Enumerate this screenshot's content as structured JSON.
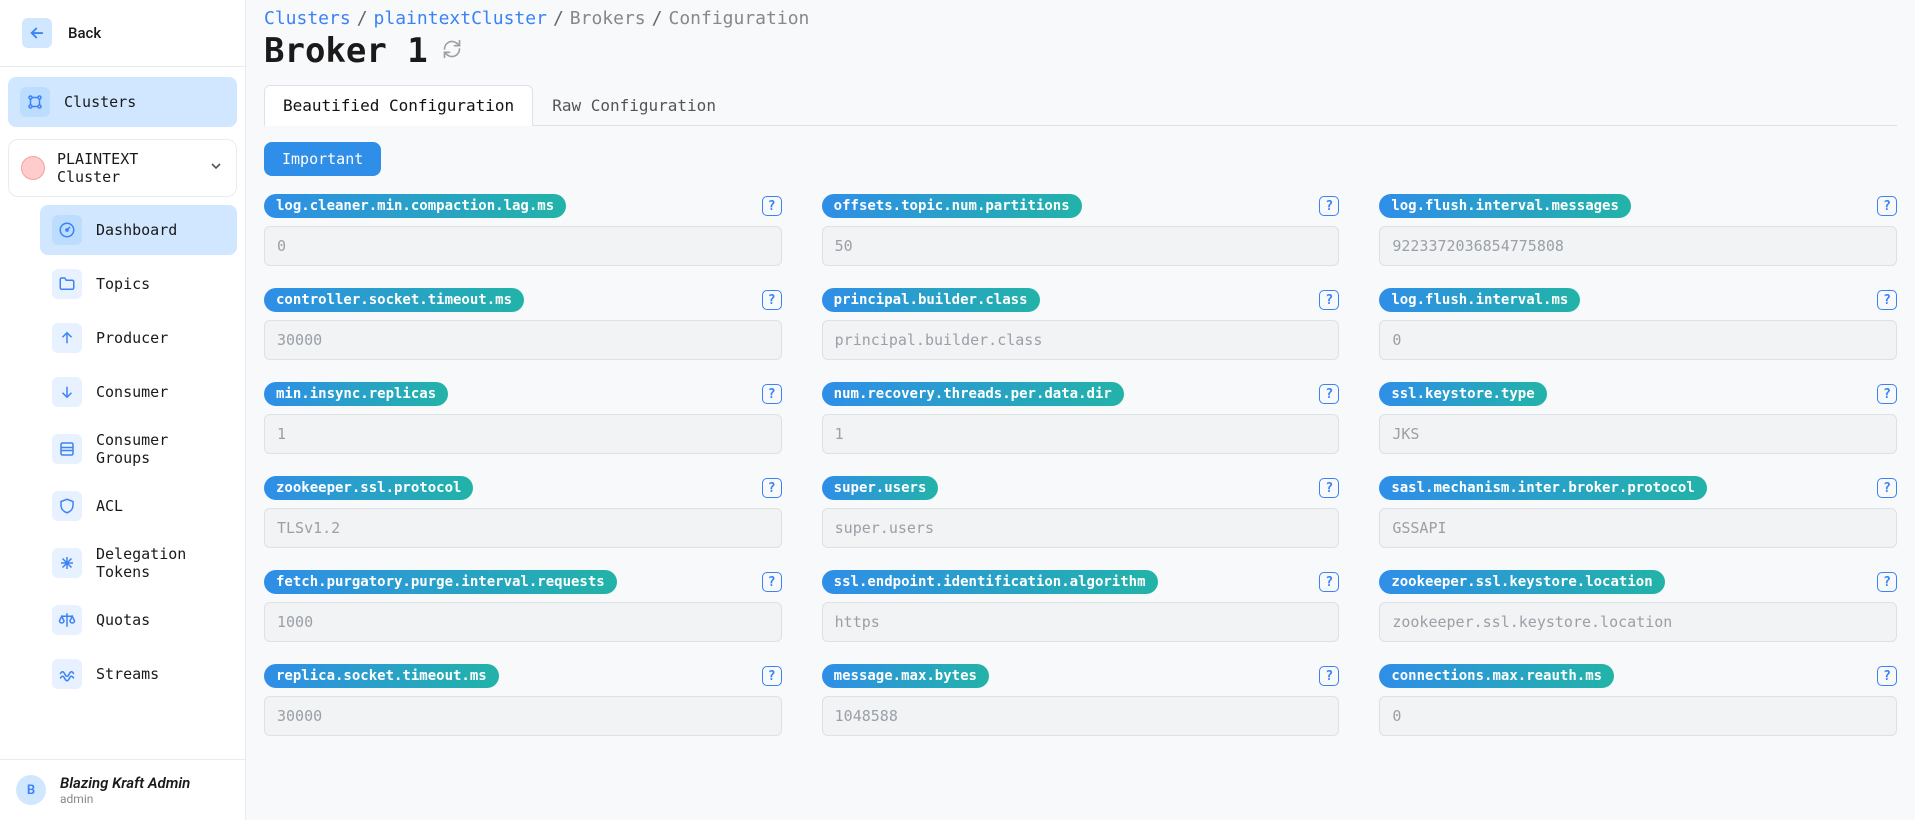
{
  "back_label": "Back",
  "sidebar": {
    "clusters_label": "Clusters",
    "cluster_selected": "PLAINTEXT Cluster",
    "nav": [
      {
        "label": "Dashboard",
        "icon": "gauge",
        "active": true
      },
      {
        "label": "Topics",
        "icon": "folder",
        "active": false
      },
      {
        "label": "Producer",
        "icon": "upload",
        "active": false
      },
      {
        "label": "Consumer",
        "icon": "download",
        "active": false
      },
      {
        "label": "Consumer Groups",
        "icon": "layers",
        "active": false
      },
      {
        "label": "ACL",
        "icon": "shield",
        "active": false
      },
      {
        "label": "Delegation Tokens",
        "icon": "asterisk",
        "active": false
      },
      {
        "label": "Quotas",
        "icon": "scale",
        "active": false
      },
      {
        "label": "Streams",
        "icon": "wave",
        "active": false
      }
    ]
  },
  "user": {
    "initial": "B",
    "name": "Blazing Kraft Admin",
    "role": "admin"
  },
  "breadcrumb": {
    "items": [
      {
        "label": "Clusters",
        "link": true
      },
      {
        "label": "plaintextCluster",
        "link": true
      },
      {
        "label": "Brokers",
        "link": false
      },
      {
        "label": "Configuration",
        "link": false
      }
    ]
  },
  "page_title": "Broker 1",
  "tabs": [
    {
      "label": "Beautified Configuration",
      "active": true
    },
    {
      "label": "Raw Configuration",
      "active": false
    }
  ],
  "filter_button": "Important",
  "configs": [
    {
      "key": "log.cleaner.min.compaction.lag.ms",
      "value": "0"
    },
    {
      "key": "offsets.topic.num.partitions",
      "value": "50"
    },
    {
      "key": "log.flush.interval.messages",
      "value": "9223372036854775808"
    },
    {
      "key": "controller.socket.timeout.ms",
      "value": "30000"
    },
    {
      "key": "principal.builder.class",
      "value": "",
      "placeholder": "principal.builder.class"
    },
    {
      "key": "log.flush.interval.ms",
      "value": "0"
    },
    {
      "key": "min.insync.replicas",
      "value": "1"
    },
    {
      "key": "num.recovery.threads.per.data.dir",
      "value": "1"
    },
    {
      "key": "ssl.keystore.type",
      "value": "JKS"
    },
    {
      "key": "zookeeper.ssl.protocol",
      "value": "TLSv1.2"
    },
    {
      "key": "super.users",
      "value": "",
      "placeholder": "super.users"
    },
    {
      "key": "sasl.mechanism.inter.broker.protocol",
      "value": "GSSAPI"
    },
    {
      "key": "fetch.purgatory.purge.interval.requests",
      "value": "1000"
    },
    {
      "key": "ssl.endpoint.identification.algorithm",
      "value": "https"
    },
    {
      "key": "zookeeper.ssl.keystore.location",
      "value": "",
      "placeholder": "zookeeper.ssl.keystore.location"
    },
    {
      "key": "replica.socket.timeout.ms",
      "value": "30000"
    },
    {
      "key": "message.max.bytes",
      "value": "1048588"
    },
    {
      "key": "connections.max.reauth.ms",
      "value": "0"
    }
  ]
}
